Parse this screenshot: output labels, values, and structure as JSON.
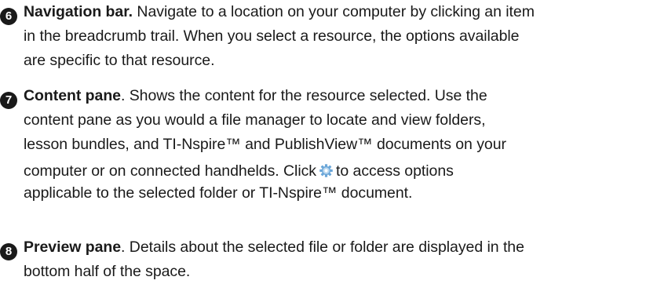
{
  "items": [
    {
      "number": "6",
      "term": "Navigation bar.",
      "lines": [
        " Navigate to a location on your computer by clicking an item",
        "in the breadcrumb trail. When you select a resource, the options available",
        "are specific to that resource."
      ]
    },
    {
      "number": "7",
      "term": "Content pane",
      "lines": [
        ". Shows the content for the resource selected. Use the",
        "content pane as you would a file manager to locate and view folders,",
        "lesson bundles, and TI-Nspire™ and PublishView™ documents on your",
        "computer or on connected handhelds. Click",
        "to access options",
        "applicable to the selected folder or TI-Nspire™ document."
      ],
      "icon": "gear-icon",
      "icon_colors": [
        "#6aa6d8",
        "#b9d7ef"
      ]
    },
    {
      "number": "8",
      "term": "Preview pane",
      "lines": [
        ". Details about the selected file or folder are displayed in the",
        "bottom half of the space."
      ]
    }
  ]
}
